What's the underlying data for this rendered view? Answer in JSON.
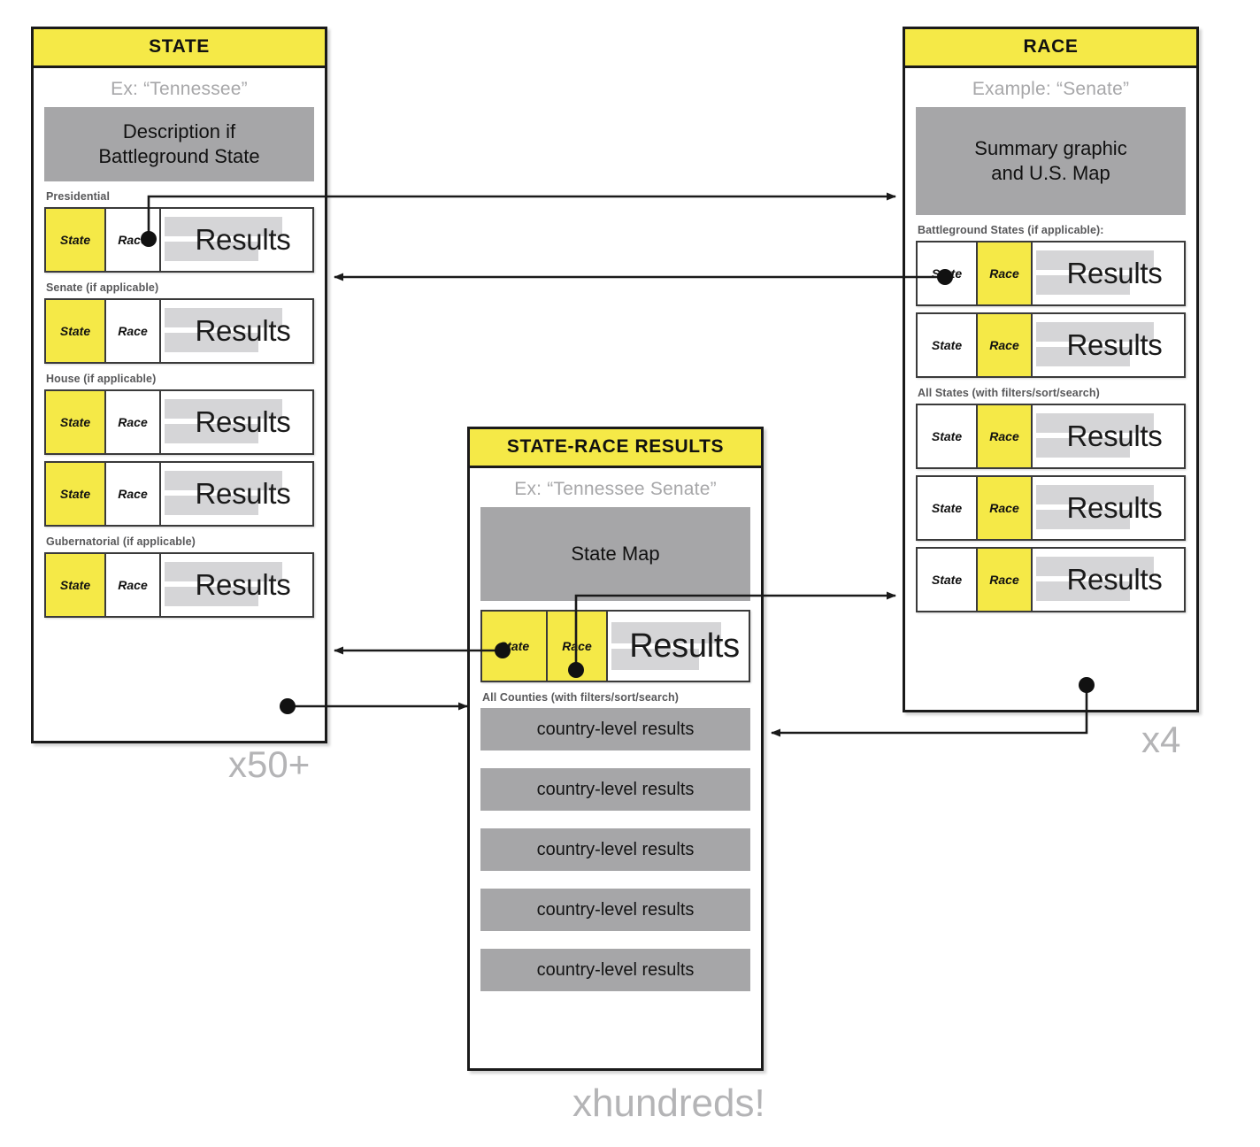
{
  "diagram": {
    "title_state": "STATE",
    "title_race": "RACE",
    "title_state_race": "STATE-RACE RESULTS",
    "multiplier_state": "x50+",
    "multiplier_race": "x4",
    "multiplier_state_race": "xhundreds!"
  },
  "labels": {
    "state_cell": "State",
    "race_cell": "Race",
    "results_cell": "Results"
  },
  "state_panel": {
    "title": "STATE",
    "example": "Ex: “Tennessee”",
    "description_block": "Description if\nBattleground State",
    "description_line1": "Description if",
    "description_line2": "Battleground State",
    "sections": [
      {
        "caption": "Presidential",
        "rows": [
          {
            "state": "State",
            "race": "Race",
            "results": "Results"
          }
        ]
      },
      {
        "caption": "Senate (if applicable)",
        "rows": [
          {
            "state": "State",
            "race": "Race",
            "results": "Results"
          }
        ]
      },
      {
        "caption": "House (if applicable)",
        "rows": [
          {
            "state": "State",
            "race": "Race",
            "results": "Results"
          },
          {
            "state": "State",
            "race": "Race",
            "results": "Results"
          }
        ]
      },
      {
        "caption": "Gubernatorial (if applicable)",
        "rows": [
          {
            "state": "State",
            "race": "Race",
            "results": "Results"
          }
        ]
      }
    ],
    "multiplier": "x50+"
  },
  "race_panel": {
    "title": "RACE",
    "example": "Example: “Senate”",
    "summary_block_line1": "Summary graphic",
    "summary_block_line2": "and U.S. Map",
    "sections": [
      {
        "caption": "Battleground States (if applicable):",
        "rows": [
          {
            "state": "State",
            "race": "Race",
            "results": "Results"
          },
          {
            "state": "State",
            "race": "Race",
            "results": "Results"
          }
        ]
      },
      {
        "caption": "All States (with filters/sort/search)",
        "rows": [
          {
            "state": "State",
            "race": "Race",
            "results": "Results"
          },
          {
            "state": "State",
            "race": "Race",
            "results": "Results"
          },
          {
            "state": "State",
            "race": "Race",
            "results": "Results"
          }
        ]
      }
    ],
    "multiplier": "x4"
  },
  "state_race_panel": {
    "title": "STATE-RACE RESULTS",
    "example": "Ex: “Tennessee Senate”",
    "map_block": "State Map",
    "main_row": {
      "state": "State",
      "race": "Race",
      "results": "Results"
    },
    "counties_caption": "All Counties (with filters/sort/search)",
    "county_rows": [
      "country-level results",
      "country-level results",
      "country-level results",
      "country-level results",
      "country-level results"
    ],
    "multiplier": "xhundreds!"
  },
  "colors": {
    "accent_yellow": "#f5e947",
    "block_gray": "#a6a6a8",
    "placeholder_gray": "#d5d5d7",
    "muted_text": "#b4b4b6",
    "caption_text": "#58585a",
    "border_dark": "#1a1a1a"
  }
}
